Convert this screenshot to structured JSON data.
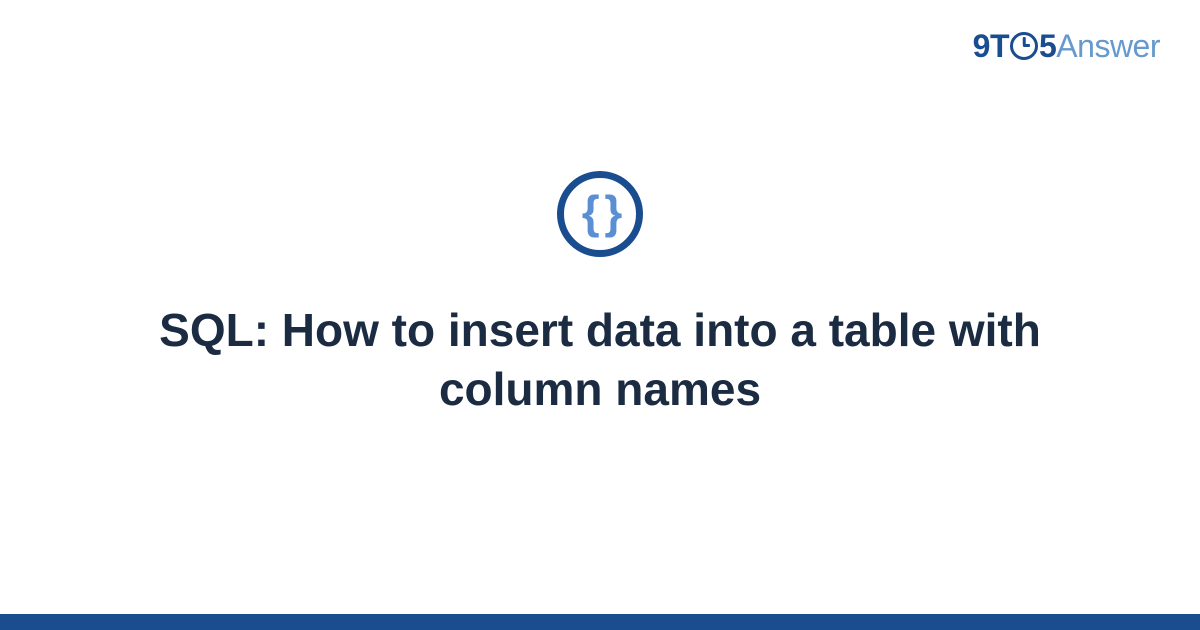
{
  "logo": {
    "nine": "9",
    "t": "T",
    "five": "5",
    "answer": "Answer"
  },
  "icon": {
    "braces": "{ }"
  },
  "title": "SQL: How to insert data into a table with column names"
}
